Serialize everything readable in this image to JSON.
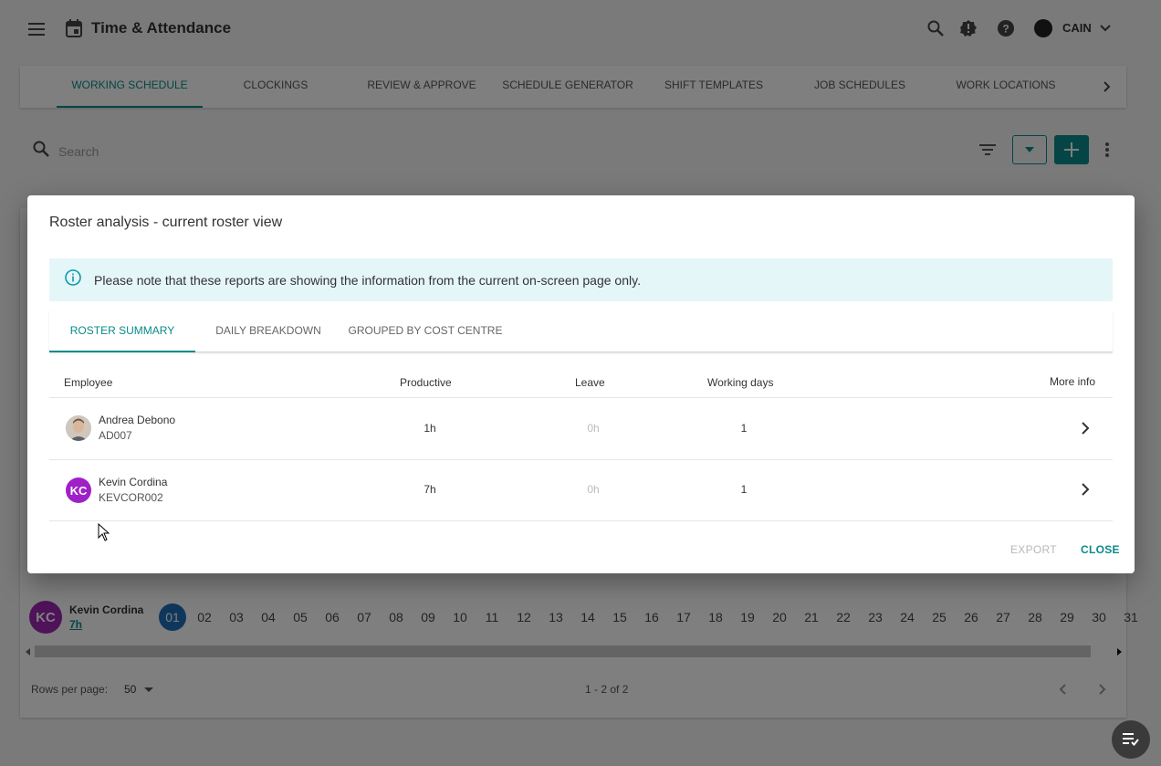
{
  "app": {
    "title": "Time & Attendance",
    "user": "CAIN"
  },
  "nav_tabs": [
    {
      "label": "WORKING SCHEDULE",
      "active": true
    },
    {
      "label": "CLOCKINGS"
    },
    {
      "label": "REVIEW & APPROVE"
    },
    {
      "label": "SCHEDULE GENERATOR"
    },
    {
      "label": "SHIFT TEMPLATES"
    },
    {
      "label": "JOB SCHEDULES"
    },
    {
      "label": "WORK LOCATIONS"
    }
  ],
  "toolbar": {
    "search_placeholder": "Search"
  },
  "background_roster": {
    "employee_initials": "KC",
    "employee_name": "Kevin Cordina",
    "employee_hours": "7h",
    "days": [
      "01",
      "02",
      "03",
      "04",
      "05",
      "06",
      "07",
      "08",
      "09",
      "10",
      "11",
      "12",
      "13",
      "14",
      "15",
      "16",
      "17",
      "18",
      "19",
      "20",
      "21",
      "22",
      "23",
      "24",
      "25",
      "26",
      "27",
      "28",
      "29",
      "30",
      "31"
    ]
  },
  "pagination": {
    "rows_label": "Rows per page:",
    "rows_value": "50",
    "range": "1 - 2 of 2"
  },
  "dialog": {
    "title": "Roster analysis - current roster view",
    "notice": "Please note that these reports are showing the information from the current on-screen page only.",
    "tabs": [
      {
        "label": "ROSTER SUMMARY",
        "active": true
      },
      {
        "label": "DAILY BREAKDOWN"
      },
      {
        "label": "GROUPED BY COST CENTRE"
      }
    ],
    "columns": {
      "employee": "Employee",
      "productive": "Productive",
      "leave": "Leave",
      "working_days": "Working days",
      "more_info": "More info"
    },
    "rows": [
      {
        "name": "Andrea Debono",
        "code": "AD007",
        "productive": "1h",
        "leave": "0h",
        "working_days": "1",
        "avatar": "photo"
      },
      {
        "name": "Kevin Cordina",
        "code": "KEVCOR002",
        "productive": "7h",
        "leave": "0h",
        "working_days": "1",
        "avatar_initials": "KC"
      }
    ],
    "buttons": {
      "export": "EXPORT",
      "close": "CLOSE"
    }
  },
  "colors": {
    "accent": "#0a8a8a",
    "avatar_kc": "#a020c8",
    "today": "#1e6fb8"
  }
}
